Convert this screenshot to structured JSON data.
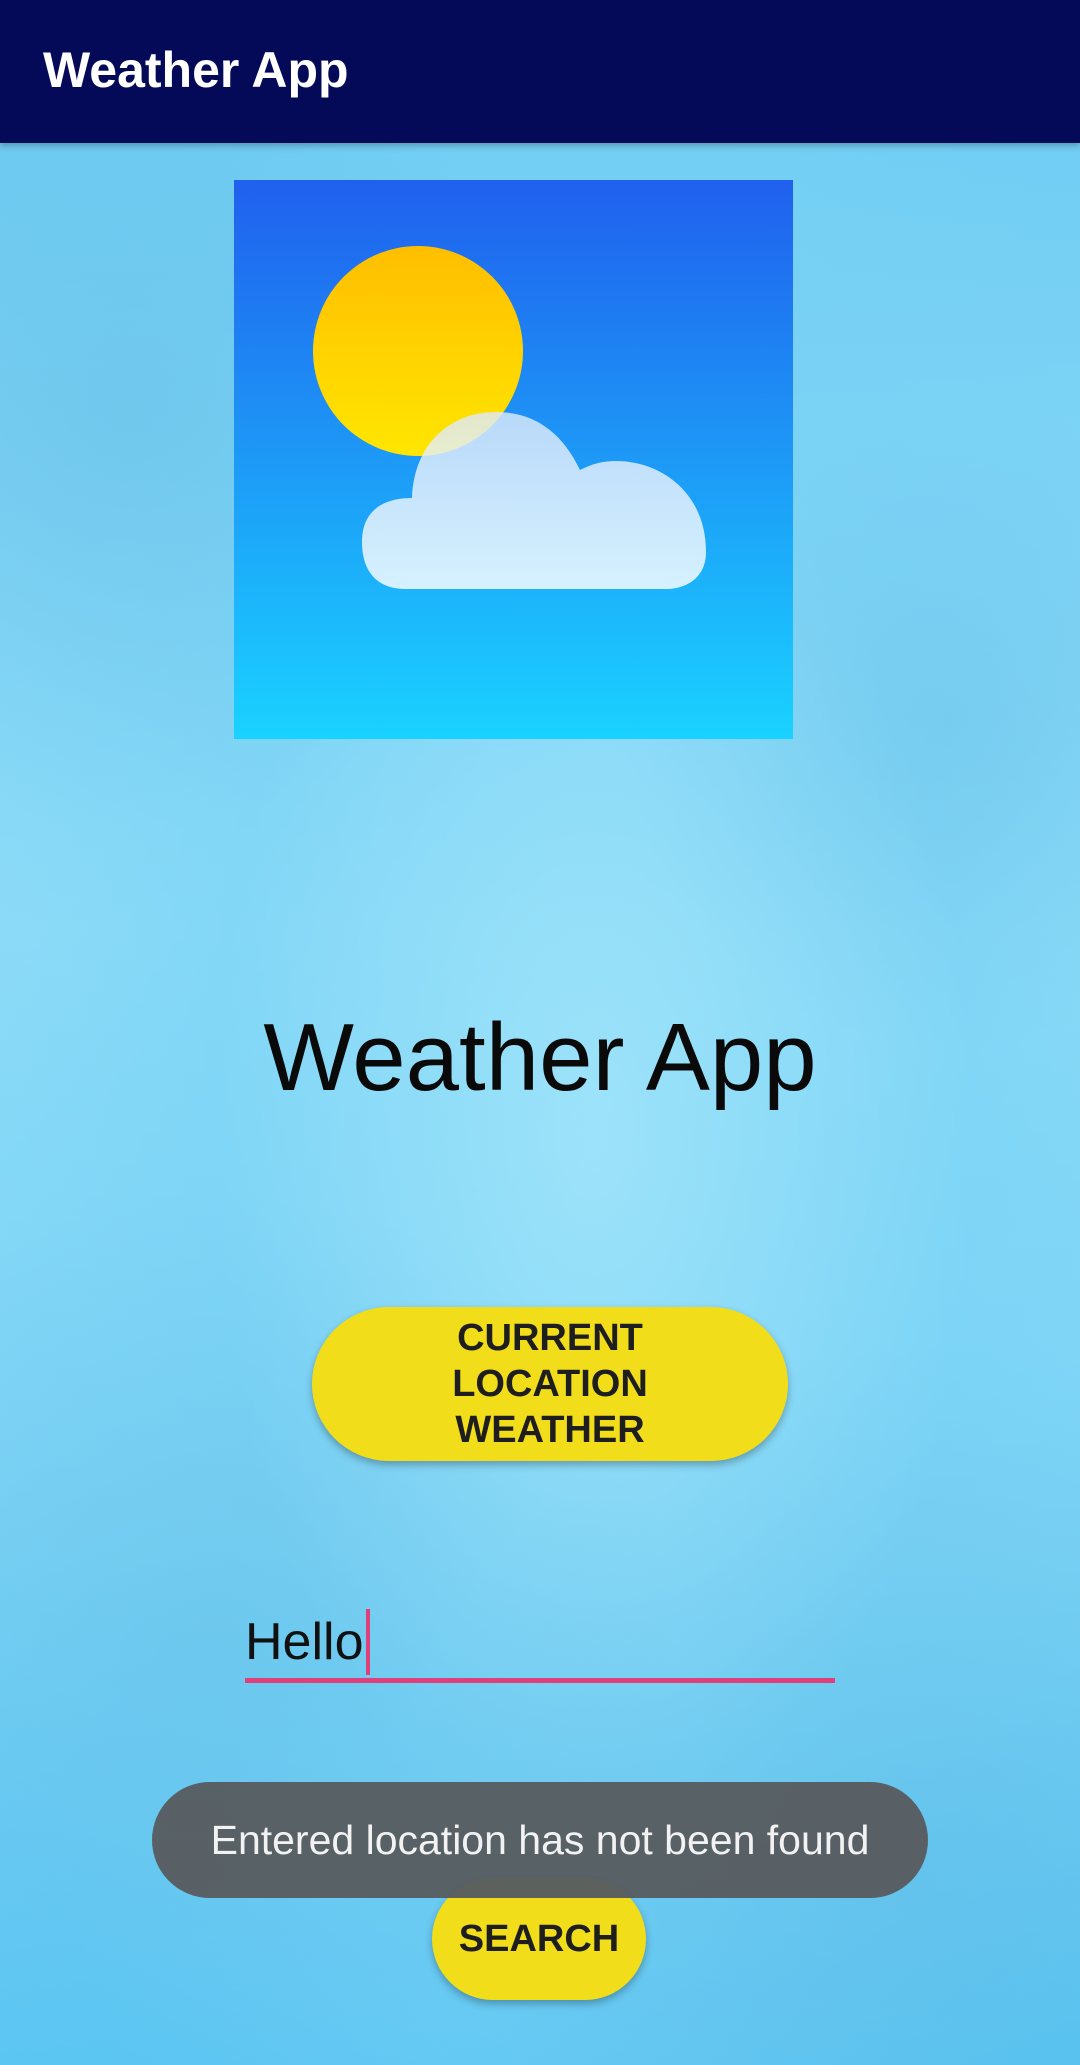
{
  "app_bar": {
    "title": "Weather App"
  },
  "logo": {
    "icon": "sun-behind-cloud-icon",
    "colors": {
      "sky_top": "#2060ee",
      "sky_bottom": "#1ad2ff",
      "sun": "#ffd400",
      "cloud": "#ffffff"
    }
  },
  "main": {
    "title": "Weather App",
    "location_button_label": "CURRENT LOCATION WEATHER",
    "search_input_value": "Hello",
    "search_button_label": "SEARCH"
  },
  "toast": {
    "message": "Entered location has not been found"
  },
  "colors": {
    "app_bar": "#050a58",
    "button": "#f2dd1a",
    "accent": "#e0407a",
    "toast": "#585d61"
  }
}
